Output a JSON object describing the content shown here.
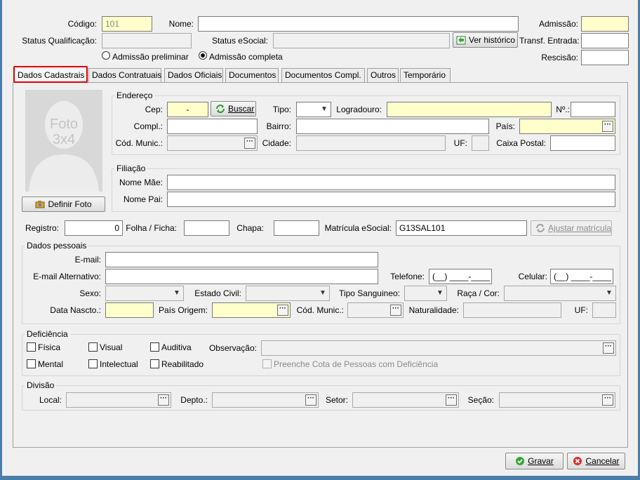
{
  "header": {
    "codigo_label": "Código:",
    "codigo_value": "101",
    "nome_label": "Nome:",
    "admissao_label": "Admissão:",
    "status_qualificacao_label": "Status Qualificação:",
    "status_esocial_label": "Status eSocial:",
    "ver_historico": "Ver histórico",
    "transf_entrada_label": "Transf. Entrada:",
    "admissao_preliminar": "Admissão preliminar",
    "admissao_completa": "Admissão completa",
    "rescisao_label": "Rescisão:"
  },
  "tabs": [
    "Dados Cadastrais",
    "Dados Contratuais",
    "Dados Oficiais",
    "Documentos",
    "Documentos Compl.",
    "Outros",
    "Temporário"
  ],
  "photo": {
    "placeholder_line1": "Foto",
    "placeholder_line2": "3x4",
    "definir_foto": "Definir Foto"
  },
  "endereco": {
    "title": "Endereço",
    "cep_label": "Cep:",
    "cep_value": "-",
    "buscar": "Buscar",
    "tipo_label": "Tipo:",
    "logradouro_label": "Logradouro:",
    "numero_label": "Nº.:",
    "compl_label": "Compl.:",
    "bairro_label": "Bairro:",
    "pais_label": "País:",
    "cod_munic_label": "Cód. Munic.:",
    "cidade_label": "Cidade:",
    "uf_label": "UF:",
    "caixa_postal_label": "Caixa Postal:"
  },
  "filiacao": {
    "title": "Filiação",
    "nome_mae_label": "Nome Mãe:",
    "nome_pai_label": "Nome Pai:"
  },
  "registro": {
    "registro_label": "Registro:",
    "registro_value": "0",
    "folha_ficha_label": "Folha / Ficha:",
    "chapa_label": "Chapa:",
    "matricula_label": "Matrícula eSocial:",
    "matricula_value": "G13SAL101",
    "ajustar_matricula": "Ajustar matrícula"
  },
  "pessoais": {
    "title": "Dados pessoais",
    "email_label": "E-mail:",
    "email_alt_label": "E-mail Alternativo:",
    "telefone_label": "Telefone:",
    "telefone_mask": "(__) ____-____",
    "celular_label": "Celular:",
    "celular_mask": "(__) ____-____",
    "sexo_label": "Sexo:",
    "estado_civil_label": "Estado Civil:",
    "tipo_sanguineo_label": "Tipo Sanguineo:",
    "raca_cor_label": "Raça / Cor:",
    "data_nascto_label": "Data Nascto.:",
    "pais_origem_label": "País Origem:",
    "cod_munic_label": "Cód. Munic.:",
    "naturalidade_label": "Naturalidade:",
    "uf_label": "UF:"
  },
  "deficiencia": {
    "title": "Deficiência",
    "fisica": "Física",
    "visual": "Visual",
    "auditiva": "Auditiva",
    "mental": "Mental",
    "intelectual": "Intelectual",
    "reabilitado": "Reabilitado",
    "observacao_label": "Observação:",
    "preenche_cota": "Preenche Cota de Pessoas com Deficiência"
  },
  "divisao": {
    "title": "Divisão",
    "local_label": "Local:",
    "depto_label": "Depto.:",
    "setor_label": "Setor:",
    "secao_label": "Seção:"
  },
  "footer": {
    "gravar": "Gravar",
    "cancelar": "Cancelar"
  },
  "colors": {
    "highlight_border": "#e00000",
    "required_field": "#ffffcc"
  }
}
